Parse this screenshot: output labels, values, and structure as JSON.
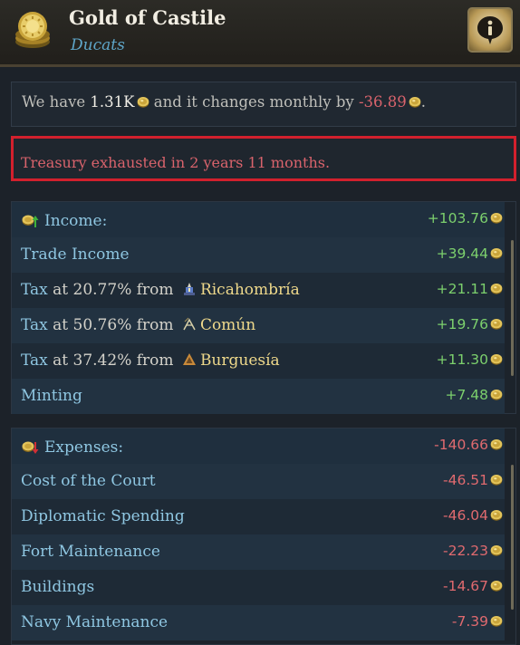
{
  "header": {
    "title": "Gold of Castile",
    "subtitle": "Ducats",
    "coin_icon": "gold-coin-stack-icon",
    "info_icon": "info-icon"
  },
  "summary": {
    "prefix": "We have ",
    "amount": "1.31K",
    "middle": " and it changes monthly by ",
    "change": "-36.89",
    "suffix": "."
  },
  "warning": {
    "text": "Treasury exhausted in 2 years 11 months."
  },
  "income": {
    "header_label": "Income:",
    "header_value": "+103.76",
    "rows": [
      {
        "label": "Trade Income",
        "value": "+39.44"
      },
      {
        "label": "Tax",
        "rest": " at 20.77% from ",
        "estate": "Ricahombría",
        "estate_icon": "clergy-estate-icon",
        "value": "+21.11"
      },
      {
        "label": "Tax",
        "rest": " at 50.76% from ",
        "estate": "Común",
        "estate_icon": "peasants-estate-icon",
        "value": "+19.76"
      },
      {
        "label": "Tax",
        "rest": " at 37.42% from ",
        "estate": "Burguesía",
        "estate_icon": "burghers-estate-icon",
        "value": "+11.30"
      },
      {
        "label": "Minting",
        "value": "+7.48"
      }
    ]
  },
  "expenses": {
    "header_label": "Expenses:",
    "header_value": "-140.66",
    "rows": [
      {
        "label": "Cost of the Court",
        "value": "-46.51"
      },
      {
        "label": "Diplomatic Spending",
        "value": "-46.04"
      },
      {
        "label": "Fort Maintenance",
        "value": "-22.23"
      },
      {
        "label": "Buildings",
        "value": "-14.67"
      },
      {
        "label": "Navy Maintenance",
        "value": "-7.39"
      }
    ]
  },
  "colors": {
    "positive": "#7cd06d",
    "negative": "#e06a6f",
    "warning_border": "#d2202d",
    "link_blue": "#8fc7e2",
    "estate_gold": "#efd98b"
  }
}
